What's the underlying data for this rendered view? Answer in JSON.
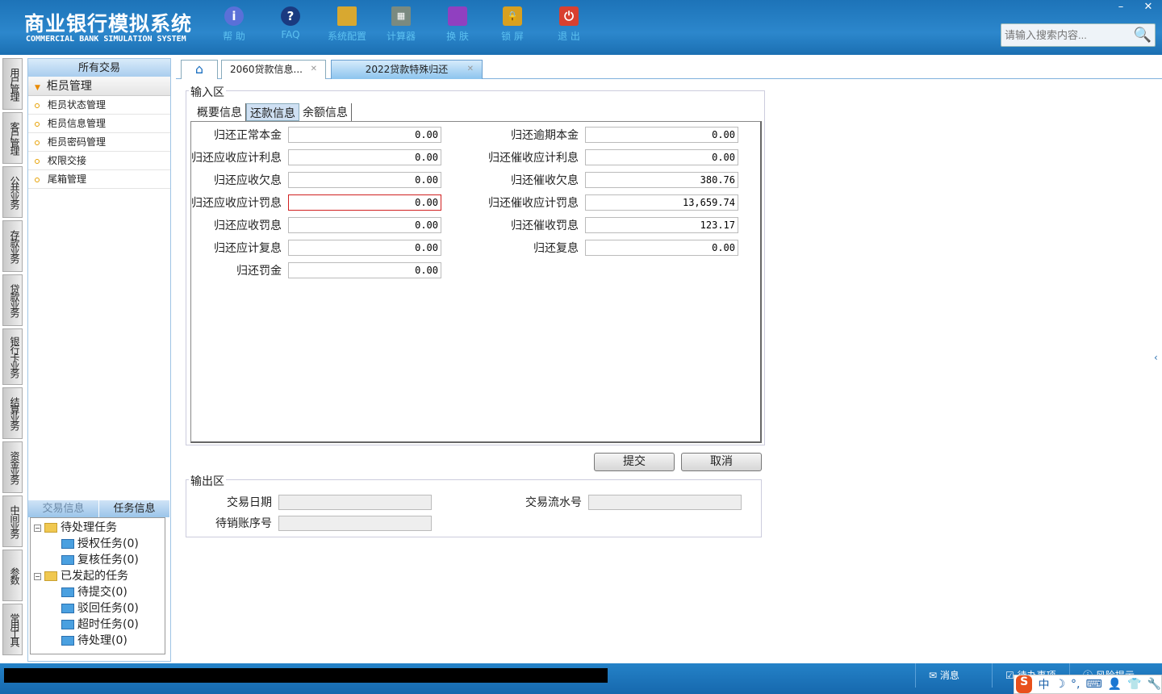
{
  "header": {
    "title": "商业银行模拟系统",
    "subtitle": "COMMERCIAL BANK SIMULATION SYSTEM",
    "tools": [
      {
        "label": "帮 助",
        "icon": "info-icon"
      },
      {
        "label": "FAQ",
        "icon": "question-icon"
      },
      {
        "label": "系统配置",
        "icon": "toolbox-icon"
      },
      {
        "label": "计算器",
        "icon": "calculator-icon"
      },
      {
        "label": "换 肤",
        "icon": "shirt-icon"
      },
      {
        "label": "锁 屏",
        "icon": "lock-icon"
      },
      {
        "label": "退 出",
        "icon": "power-icon"
      }
    ],
    "search_placeholder": "请输入搜索内容..."
  },
  "vtabs": [
    "用户管理",
    "客户管理",
    "公共业务",
    "存款业务",
    "贷款业务",
    "银行卡业务",
    "结算业务",
    "资金业务",
    "中间业务",
    "参数",
    "常用工具"
  ],
  "left": {
    "header": "所有交易",
    "group": "柜员管理",
    "items": [
      "柜员状态管理",
      "柜员信息管理",
      "柜员密码管理",
      "权限交接",
      "尾箱管理"
    ],
    "task_tabs": [
      "交易信息",
      "任务信息"
    ],
    "tree": [
      {
        "label": "待处理任务",
        "children": [
          "授权任务(0)",
          "复核任务(0)"
        ]
      },
      {
        "label": "已发起的任务",
        "children": [
          "待提交(0)",
          "驳回任务(0)",
          "超时任务(0)",
          "待处理(0)"
        ]
      }
    ]
  },
  "tabs": [
    {
      "label": "2060贷款信息..."
    },
    {
      "label": "2022贷款特殊归还"
    }
  ],
  "input_area": {
    "title": "输入区",
    "subtabs": [
      "概要信息",
      "还款信息",
      "余额信息"
    ],
    "left_fields": [
      {
        "label": "归还正常本金",
        "value": "0.00"
      },
      {
        "label": "归还应收应计利息",
        "value": "0.00"
      },
      {
        "label": "归还应收欠息",
        "value": "0.00"
      },
      {
        "label": "归还应收应计罚息",
        "value": "0.00"
      },
      {
        "label": "归还应收罚息",
        "value": "0.00"
      },
      {
        "label": "归还应计复息",
        "value": "0.00"
      },
      {
        "label": "归还罚金",
        "value": "0.00"
      }
    ],
    "right_fields": [
      {
        "label": "归还逾期本金",
        "value": "0.00"
      },
      {
        "label": "归还催收应计利息",
        "value": "0.00"
      },
      {
        "label": "归还催收欠息",
        "value": "380.76"
      },
      {
        "label": "归还催收应计罚息",
        "value": "13,659.74"
      },
      {
        "label": "归还催收罚息",
        "value": "123.17"
      },
      {
        "label": "归还复息",
        "value": "0.00"
      }
    ]
  },
  "buttons": {
    "submit": "提交",
    "cancel": "取消"
  },
  "output_area": {
    "title": "输出区",
    "trade_date": "交易日期",
    "serial_no": "交易流水号",
    "account": "待销账序号"
  },
  "status": {
    "messages": "消息",
    "todo": "待办事项",
    "risk": "风险提示",
    "ime": "中"
  }
}
